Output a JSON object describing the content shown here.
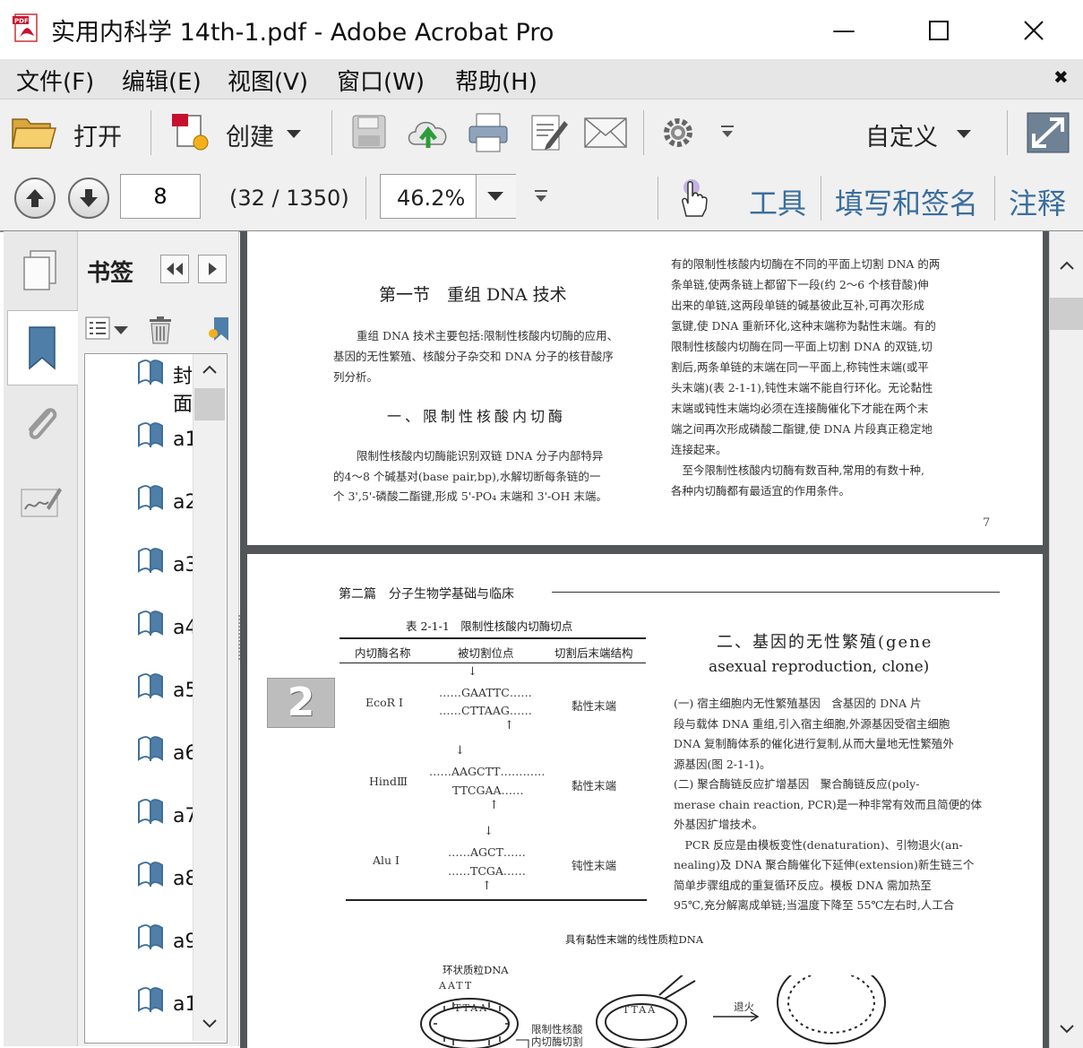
{
  "window": {
    "title": "实用内科学 14th-1.pdf - Adobe Acrobat Pro",
    "minimize": "—",
    "maximize": "☐",
    "close": "✕"
  },
  "menu": {
    "items": [
      "文件(F)",
      "编辑(E)",
      "视图(V)",
      "窗口(W)",
      "帮助(H)"
    ],
    "close_doc": "✖"
  },
  "toolbar": {
    "open_label": "打开",
    "create_label": "创建",
    "customize_label": "自定义",
    "icons": [
      "folder-icon",
      "create-pdf-icon",
      "save-icon",
      "cloud-upload-icon",
      "print-icon",
      "edit-icon",
      "email-icon",
      "gear-icon",
      "expand-icon"
    ]
  },
  "nav": {
    "page_value": "8",
    "page_count": "(32 / 1350)",
    "zoom_value": "46.2%",
    "pane_tools": "工具",
    "pane_sign": "填写和签名",
    "pane_comment": "注释"
  },
  "bookmarks": {
    "title": "书签",
    "items": [
      {
        "label": "封面"
      },
      {
        "label": "a1"
      },
      {
        "label": "a2"
      },
      {
        "label": "a3"
      },
      {
        "label": "a4"
      },
      {
        "label": "a5"
      },
      {
        "label": "a6"
      },
      {
        "label": "a7"
      },
      {
        "label": "a8"
      },
      {
        "label": "a9"
      },
      {
        "label": "a1"
      }
    ]
  },
  "page7": {
    "section_title": "第一节　重组 DNA 技术",
    "intro": [
      "重组 DNA 技术主要包括:限制性核酸内切酶的应用、",
      "基因的无性繁殖、核酸分子杂交和 DNA 分子的核苷酸序",
      "列分析。"
    ],
    "subtitle": "一、限制性核酸内切酶",
    "para1": [
      "限制性核酸内切酶能识别双链 DNA 分子内部特异",
      "的4～8 个碱基对(base pair,bp),水解切断每条链的一",
      "个 3',5'-磷酸二酯键,形成 5'-PO₄ 末端和 3'-OH 末端。"
    ],
    "right_col": [
      "有的限制性核酸内切酶在不同的平面上切割 DNA 的两",
      "条单链,使两条链上都留下一段(约 2～6 个核苷酸)伸",
      "出来的单链,这两段单链的碱基彼此互补,可再次形成",
      "氢键,使 DNA 重新环化,这种末端称为黏性末端。有的",
      "限制性核酸内切酶在同一平面上切割 DNA 的双链,切",
      "割后,两条单链的末端在同一平面上,称钝性末端(或平",
      "头末端)(表 2-1-1),钝性末端不能自行环化。无论黏性",
      "末端或钝性末端均必须在连接酶催化下才能在两个末",
      "端之间再次形成磷酸二酯键,使 DNA 片段真正稳定地",
      "连接起来。",
      "　至今限制性核酸内切酶有数百种,常用的有数十种,",
      "各种内切酶都有最适宜的作用条件。"
    ],
    "page_number": "7"
  },
  "page8": {
    "header": "第二篇　分子生物学基础与临床",
    "tab_marker": "2",
    "table_caption": "表 2-1-1　限制性核酸内切酶切点",
    "table_headers": [
      "内切酶名称",
      "被切割位点",
      "切割后末端结构"
    ],
    "table_rows": [
      {
        "enzyme": "EcoR Ⅰ",
        "site_top": "……GAATTC……",
        "site_bottom": "……CTTAAG……",
        "end": "黏性末端"
      },
      {
        "enzyme": "HindⅢ",
        "site_top": "……AAGCTT…………",
        "site_bottom": "TTCGAA……",
        "end": "黏性末端"
      },
      {
        "enzyme": "Alu Ⅰ",
        "site_top": "……AGCT……",
        "site_bottom": "……TCGA……",
        "end": "钝性末端"
      }
    ],
    "right_title_1": "二、基因的无性繁殖(gene",
    "right_title_2": "asexual reproduction, clone)",
    "right_text": [
      "(一) 宿主细胞内无性繁殖基因　含基因的 DNA 片",
      "段与载体 DNA 重组,引入宿主细胞,外源基因受宿主细胞",
      "DNA 复制酶体系的催化进行复制,从而大量地无性繁殖外",
      "源基因(图 2-1-1)。",
      "(二) 聚合酶链反应扩增基因　聚合酶链反应(poly-",
      "merase chain reaction, PCR)是一种非常有效而且简便的体",
      "外基因扩增技术。",
      "　PCR 反应是由模板变性(denaturation)、引物退火(an-",
      "nealing)及 DNA 聚合酶催化下延伸(extension)新生链三个",
      "简单步骤组成的重复循环反应。模板 DNA 需加热至",
      "95℃,充分解离成单链;当温度下降至 55℃左右时,人工合"
    ],
    "figure_title": "具有黏性末端的线性质粒DNA",
    "figure_label_ring": "环状质粒DNA",
    "figure_label_cut": "限制性核酸",
    "figure_label_cut2": "内切酶切割",
    "figure_label_anneal": "退火",
    "seq_aatt": "AATT",
    "seq_ttaa": "TTAA"
  }
}
